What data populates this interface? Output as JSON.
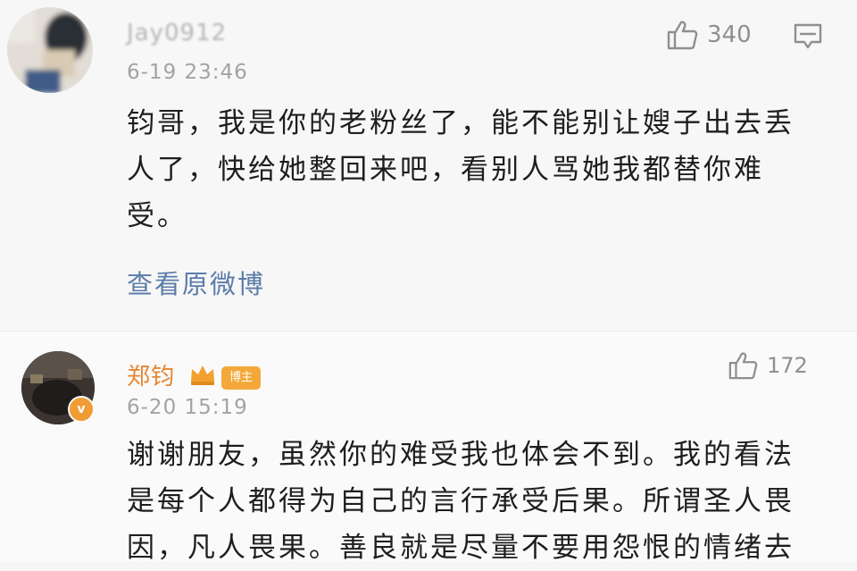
{
  "comments": [
    {
      "username": "Jay0912",
      "timestamp": "6-19 23:46",
      "likes": "340",
      "text": "钧哥，我是你的老粉丝了，能不能别让嫂子出去丢人了，快给她整回来吧，看别人骂她我都替你难受。",
      "link": "查看原微博"
    },
    {
      "username": "郑钧",
      "timestamp": "6-20 15:19",
      "likes": "172",
      "badge": "博主",
      "verified_mark": "v",
      "text": "谢谢朋友，虽然你的难受我也体会不到。我的看法是每个人都得为自己的言行承受后果。所谓圣人畏因，凡人畏果。善良就是尽量不要用怨恨的情绪去"
    }
  ],
  "icons": {
    "like": "thumbs-up-icon",
    "comment": "comment-icon",
    "crown": "crown-icon",
    "verified": "verified-badge-icon"
  },
  "colors": {
    "author_name": "#e68632",
    "link": "#5b7ca8",
    "badge": "#f4a83a"
  }
}
